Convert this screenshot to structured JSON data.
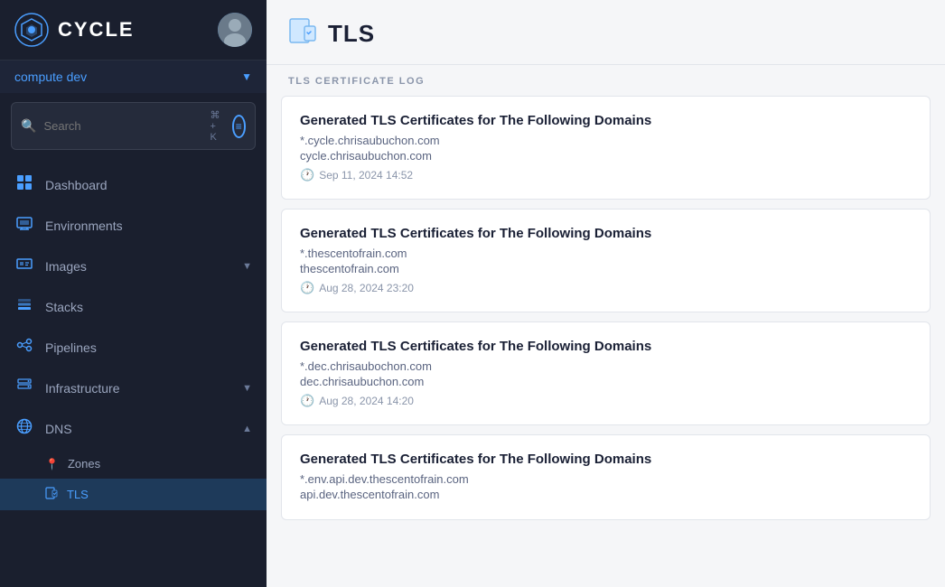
{
  "app": {
    "name": "CYCLE"
  },
  "sidebar": {
    "workspace": "compute dev",
    "search_placeholder": "Search",
    "search_shortcut": "⌘ + K",
    "nav_items": [
      {
        "id": "dashboard",
        "label": "Dashboard",
        "icon": "🏠",
        "has_chevron": false
      },
      {
        "id": "environments",
        "label": "Environments",
        "icon": "🖥",
        "has_chevron": false
      },
      {
        "id": "images",
        "label": "Images",
        "icon": "📦",
        "has_chevron": true
      },
      {
        "id": "stacks",
        "label": "Stacks",
        "icon": "📚",
        "has_chevron": false
      },
      {
        "id": "pipelines",
        "label": "Pipelines",
        "icon": "👥",
        "has_chevron": false
      },
      {
        "id": "infrastructure",
        "label": "Infrastructure",
        "icon": "🗄",
        "has_chevron": true
      },
      {
        "id": "dns",
        "label": "DNS",
        "icon": "🌐",
        "has_chevron": true,
        "expanded": true
      }
    ],
    "dns_sub_items": [
      {
        "id": "zones",
        "label": "Zones",
        "icon": "📍",
        "active": false
      },
      {
        "id": "tls",
        "label": "TLS",
        "icon": "📄",
        "active": true
      }
    ]
  },
  "page": {
    "title": "TLS",
    "icon": "🔒",
    "section_label": "TLS CERTIFICATE LOG"
  },
  "log_entries": [
    {
      "id": 1,
      "title": "Generated TLS Certificates for The Following Domains",
      "domains": [
        "*.cycle.chrisaubuchon.com",
        "cycle.chrisaubuchon.com"
      ],
      "timestamp": "Sep 11, 2024 14:52"
    },
    {
      "id": 2,
      "title": "Generated TLS Certificates for The Following Domains",
      "domains": [
        "*.thescentofrain.com",
        "thescentofrain.com"
      ],
      "timestamp": "Aug 28, 2024 23:20"
    },
    {
      "id": 3,
      "title": "Generated TLS Certificates for The Following Domains",
      "domains": [
        "*.dec.chrisaubochon.com",
        "dec.chrisaubuchon.com"
      ],
      "timestamp": "Aug 28, 2024 14:20"
    },
    {
      "id": 4,
      "title": "Generated TLS Certificates for The Following Domains",
      "domains": [
        "*.env.api.dev.thescentofrain.com",
        "api.dev.thescentofrain.com"
      ],
      "timestamp": ""
    }
  ]
}
